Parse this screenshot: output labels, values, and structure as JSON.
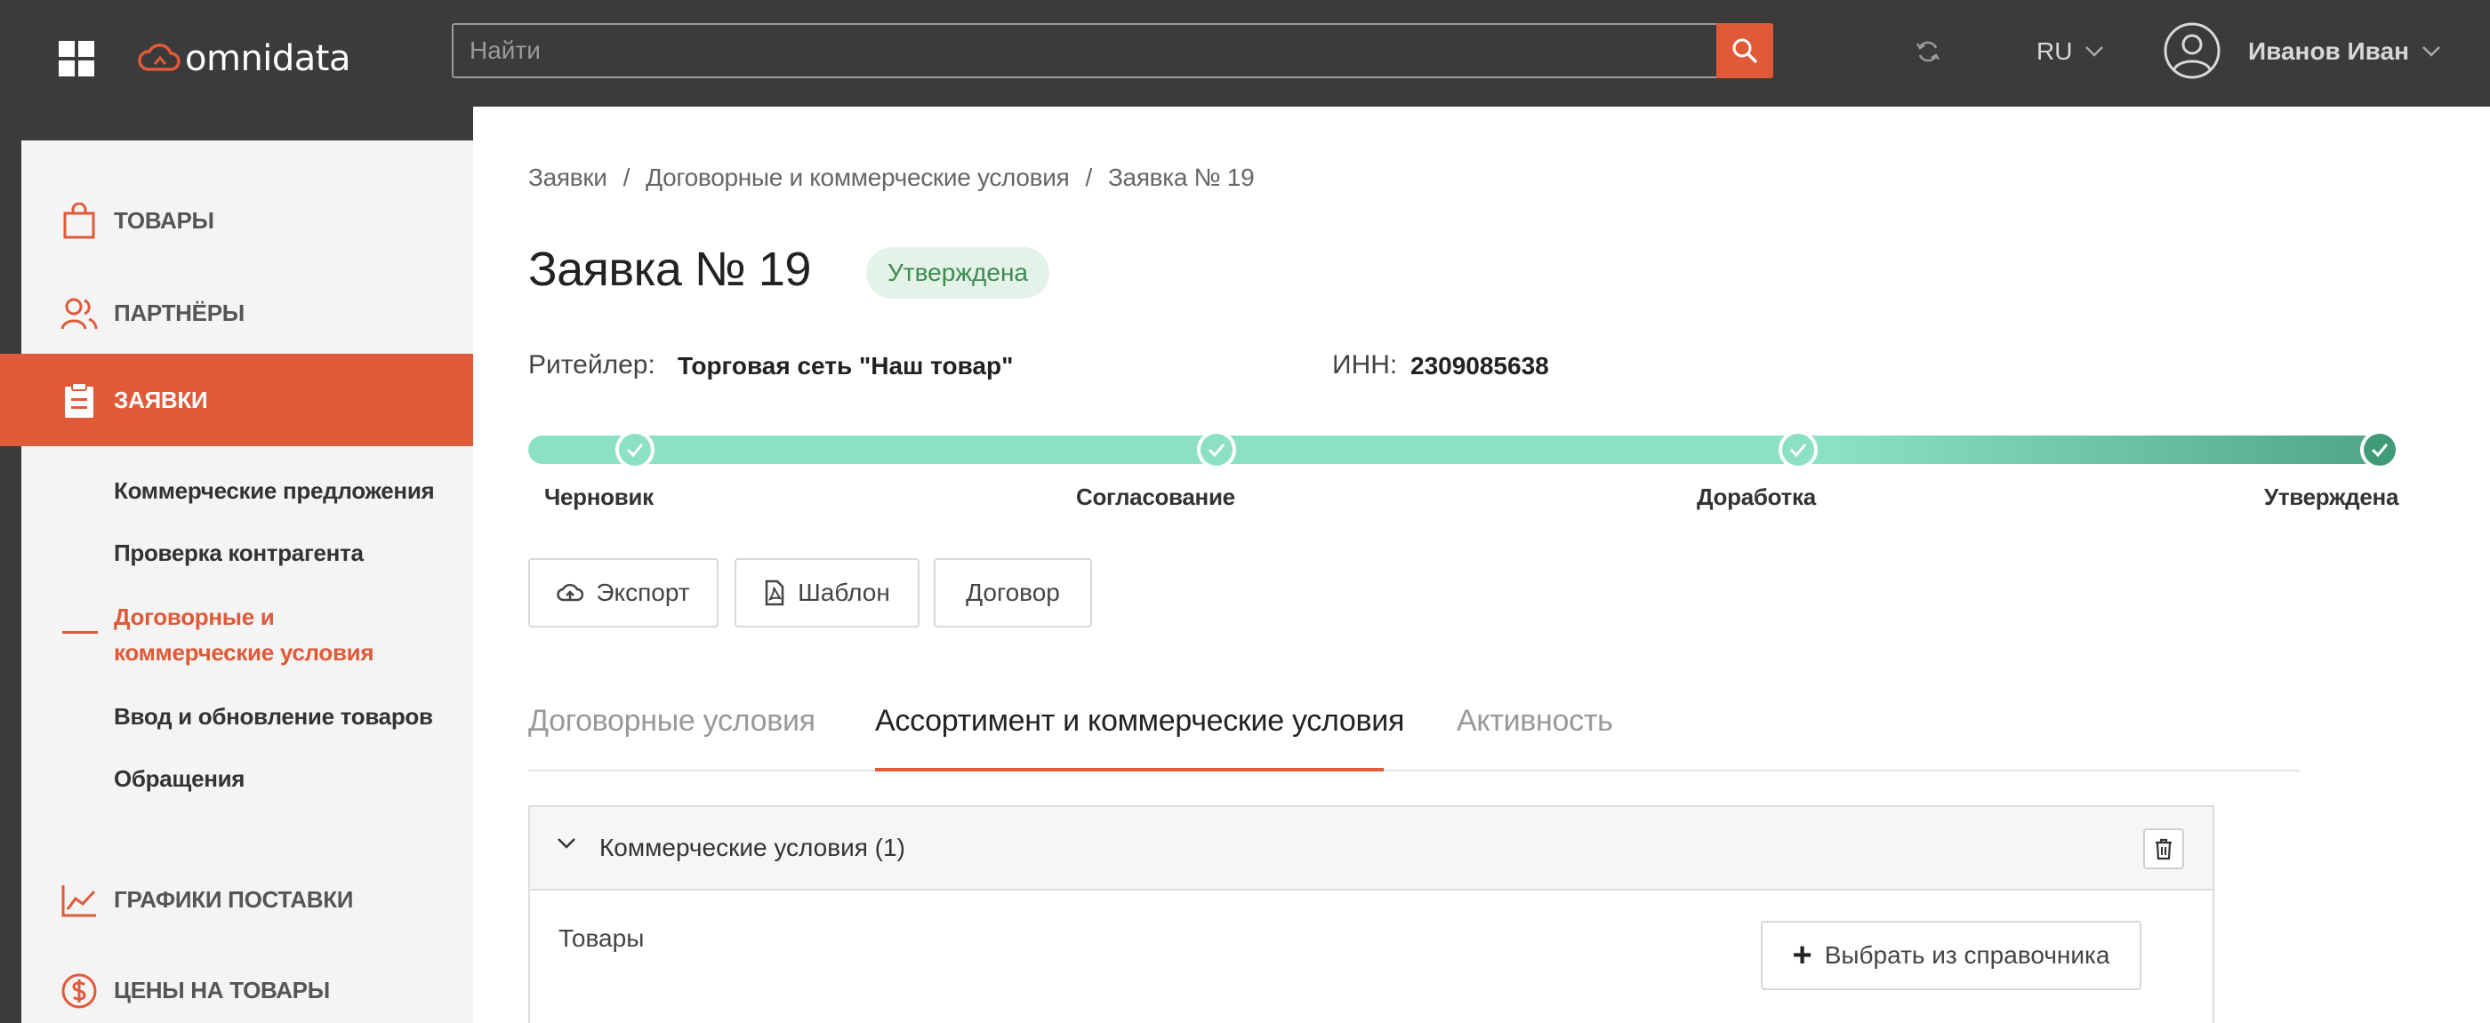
{
  "colors": {
    "accent": "#e05a38",
    "topbar": "#3b3b3b",
    "progress": "#8be0c6",
    "progress_end": "#3f9b78",
    "badge_text": "#3d8a52"
  },
  "header": {
    "brand": "omnidata",
    "search_placeholder": "Найти",
    "language": "RU",
    "user_name": "Иванов Иван"
  },
  "sidebar": {
    "items": [
      {
        "label": "ТОВАРЫ",
        "icon": "shopping-bag-icon"
      },
      {
        "label": "ПАРТНЁРЫ",
        "icon": "users-icon"
      },
      {
        "label": "ЗАЯВКИ",
        "icon": "clipboard-icon",
        "active": true
      },
      {
        "label": "ГРАФИКИ ПОСТАВКИ",
        "icon": "chart-line-icon"
      },
      {
        "label": "ЦЕНЫ НА ТОВАРЫ",
        "icon": "dollar-circle-icon"
      }
    ],
    "sub_items": [
      "Коммерческие предложения",
      "Проверка контрагента",
      "Договорные и",
      "коммерческие условия",
      "Ввод и обновление товаров",
      "Обращения"
    ]
  },
  "breadcrumb": [
    "Заявки",
    "Договорные и коммерческие условия",
    "Заявка № 19"
  ],
  "page": {
    "title": "Заявка № 19",
    "status": "Утверждена",
    "retailer_label": "Ритейлер:",
    "retailer_value": "Торговая сеть \"Наш товар\"",
    "inn_label": "ИНН:",
    "inn_value": "2309085638"
  },
  "progress": {
    "steps": [
      "Черновик",
      "Согласование",
      "Доработка",
      "Утверждена"
    ],
    "completed": 4
  },
  "actions": {
    "export": "Экспорт",
    "template": "Шаблон",
    "contract": "Договор"
  },
  "tabs": [
    "Договорные условия",
    "Ассортимент и коммерческие условия",
    "Активность"
  ],
  "active_tab": 1,
  "section": {
    "title": "Коммерческие условия (1)",
    "goods_label": "Товары",
    "pick_button": "Выбрать из справочника"
  }
}
